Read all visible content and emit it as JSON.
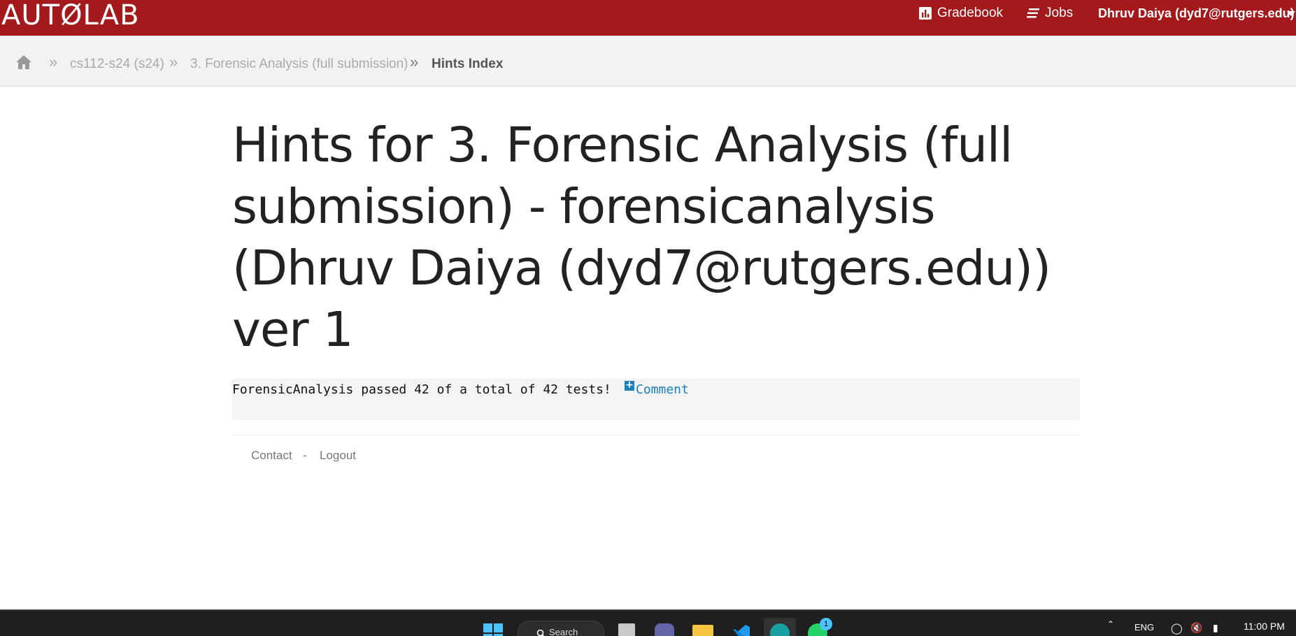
{
  "header": {
    "brand": "AUTØLAB",
    "gradebook_label": "Gradebook",
    "jobs_label": "Jobs",
    "user_label": "Dhruv Daiya (dyd7@rutgers.edu)"
  },
  "breadcrumb": {
    "items": [
      "cs112-s24 (s24)",
      "3. Forensic Analysis (full submission)",
      "Hints Index"
    ],
    "separator": "»"
  },
  "main": {
    "title": "Hints for 3. Forensic Analysis (full submission) - forensicanalysis (Dhruv Daiya (dyd7@rutgers.edu)) ver 1",
    "hint_text": "ForensicAnalysis passed 42 of a total of 42 tests!",
    "comment_label": "Comment"
  },
  "footer": {
    "contact_label": "Contact",
    "dash": "-",
    "logout_label": "Logout"
  },
  "taskbar": {
    "search_label": "Search",
    "language": "ENG",
    "time": "11:00 PM",
    "badge_count": "1"
  },
  "colors": {
    "header_bg": "#a4191c",
    "link": "#1a7fc0",
    "crumb_bg": "#f2f2f2"
  }
}
